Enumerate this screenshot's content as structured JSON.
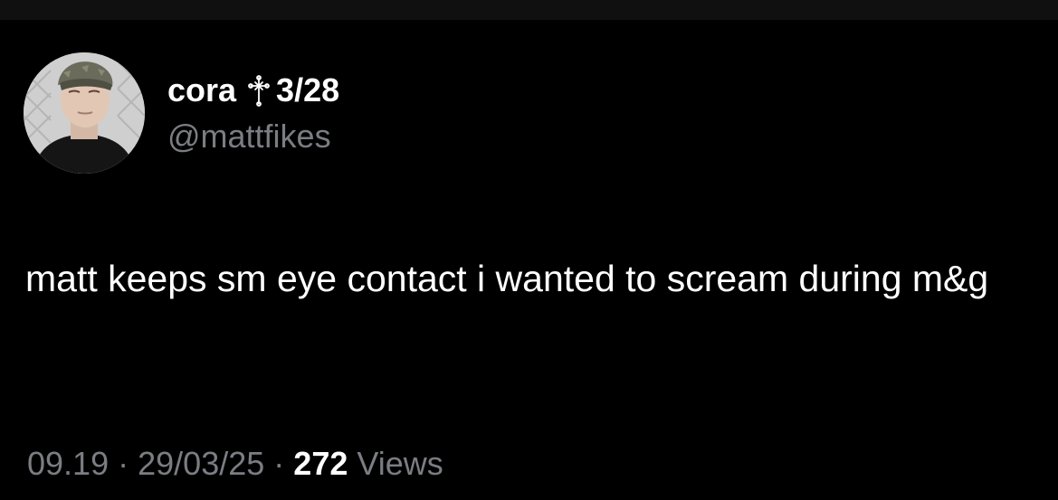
{
  "tweet": {
    "display_name": "cora",
    "name_suffix": "3/28",
    "handle": "@mattfikes",
    "text": "matt keeps sm eye contact i wanted to scream during m&g",
    "time": "09.19",
    "date": "29/03/25",
    "separator": "·",
    "views_count": "272",
    "views_label": "Views"
  },
  "icons": {
    "avatar": "profile-avatar",
    "name_decoration": "cross-icon"
  },
  "colors": {
    "background": "#000000",
    "primary_text": "#ffffff",
    "secondary_text": "#7a7d82"
  }
}
